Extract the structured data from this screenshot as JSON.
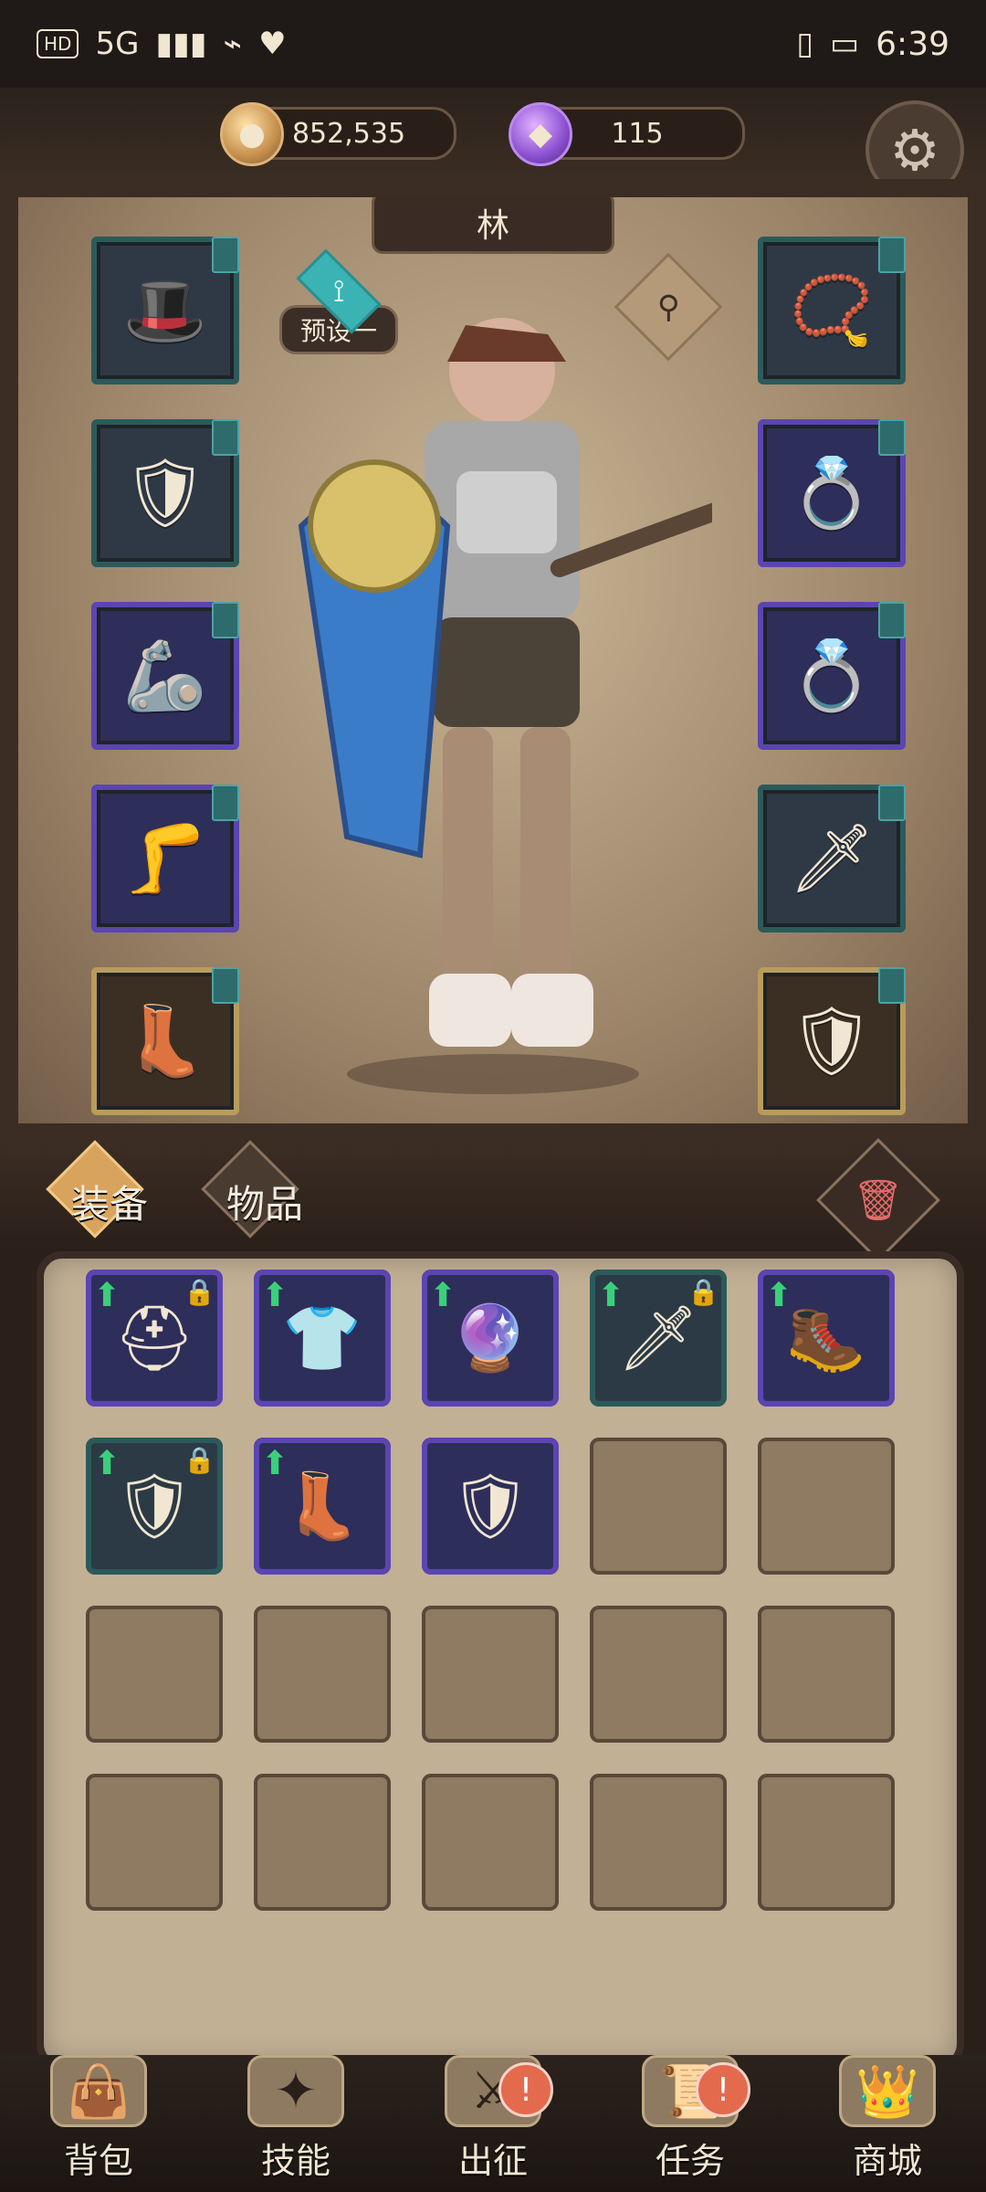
{
  "status": {
    "hd": "HD",
    "network": "5G",
    "time": "6:39"
  },
  "resources": {
    "gold": "852,535",
    "gems": "115"
  },
  "character": {
    "name": "林",
    "preset_label": "预设一"
  },
  "equip_slots": {
    "left": [
      {
        "icon": "hat-icon"
      },
      {
        "icon": "chest-armor-icon"
      },
      {
        "icon": "gauntlet-icon"
      },
      {
        "icon": "leg-armor-icon"
      },
      {
        "icon": "boots-icon"
      }
    ],
    "right": [
      {
        "icon": "amulet-icon"
      },
      {
        "icon": "ring-icon"
      },
      {
        "icon": "ring-icon"
      },
      {
        "icon": "dagger-icon"
      },
      {
        "icon": "shield-icon"
      }
    ]
  },
  "inventory": {
    "tabs": [
      "装备",
      "物品"
    ],
    "items": [
      {
        "icon": "helmet-icon",
        "up": true,
        "lock": true
      },
      {
        "icon": "shirt-icon",
        "up": true,
        "lock": false
      },
      {
        "icon": "pendant-icon",
        "up": true,
        "lock": false
      },
      {
        "icon": "dagger-icon",
        "up": true,
        "lock": true
      },
      {
        "icon": "boots-icon",
        "up": true,
        "lock": false
      },
      {
        "icon": "armor-icon",
        "up": true,
        "lock": true
      },
      {
        "icon": "greaves-icon",
        "up": true,
        "lock": false
      },
      {
        "icon": "shield-icon",
        "up": false,
        "lock": false
      }
    ]
  },
  "nav": {
    "items": [
      {
        "label": "背包",
        "icon": "bag-icon",
        "alert": false
      },
      {
        "label": "技能",
        "icon": "skill-icon",
        "alert": false
      },
      {
        "label": "出征",
        "icon": "battle-icon",
        "alert": true
      },
      {
        "label": "任务",
        "icon": "quest-icon",
        "alert": true
      },
      {
        "label": "商城",
        "icon": "shop-icon",
        "alert": false
      }
    ]
  }
}
